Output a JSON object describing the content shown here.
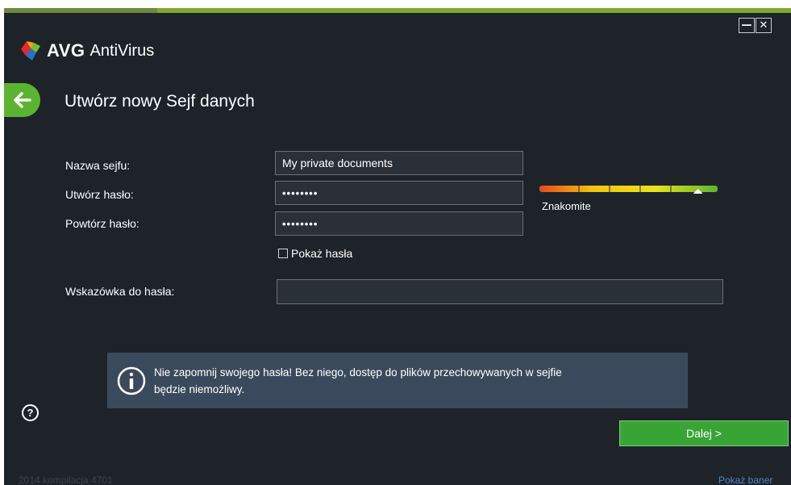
{
  "app": {
    "brand": "AVG",
    "product": "AntiVirus"
  },
  "window_controls": {
    "minimize": "—",
    "close": "✕"
  },
  "page": {
    "title": "Utwórz nowy Sejf danych"
  },
  "form": {
    "vault_name": {
      "label": "Nazwa sejfu:",
      "value": "My private documents"
    },
    "password": {
      "label": "Utwórz hasło:",
      "value": "••••••••"
    },
    "repeat": {
      "label": "Powtórz hasło:",
      "value": "••••••••"
    },
    "show_passwords": {
      "label": "Pokaż hasła",
      "checked": false
    },
    "hint": {
      "label": "Wskazówka do hasła:",
      "value": ""
    }
  },
  "strength": {
    "label": "Znakomite",
    "level": 0.89,
    "colors": [
      "#e84a1c",
      "#f1c40f",
      "#e8e31a",
      "#5bb431"
    ]
  },
  "info": {
    "text_line1": "Nie zapomnij swojego hasła! Bez niego, dostęp do plików przechowywanych w sejfie",
    "text_line2": "będzie niemożliwy."
  },
  "buttons": {
    "next": "Dalej >",
    "help": "?"
  },
  "footer": {
    "build": "2014  kompilacja 4701",
    "banner_link": "Pokaż baner"
  },
  "icons": {
    "back": "back-arrow-icon",
    "info": "info-icon",
    "help": "help-icon"
  }
}
